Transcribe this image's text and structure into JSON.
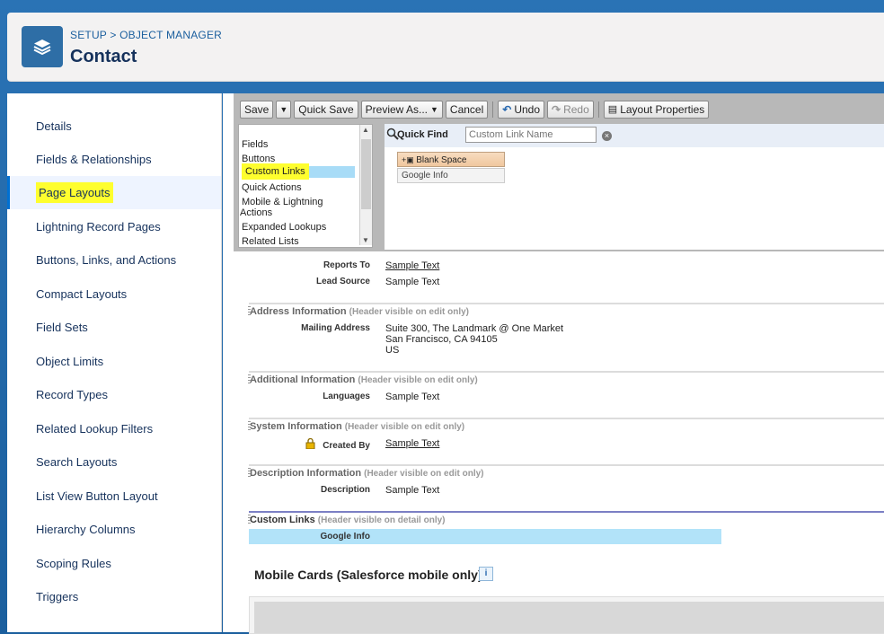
{
  "header": {
    "breadcrumb_setup": "SETUP",
    "breadcrumb_sep": ">",
    "breadcrumb_object_manager": "OBJECT MANAGER",
    "title": "Contact",
    "icon": "layers-icon"
  },
  "sidebar": {
    "items": [
      {
        "label": "Details"
      },
      {
        "label": "Fields & Relationships"
      },
      {
        "label": "Page Layouts",
        "active": true
      },
      {
        "label": "Lightning Record Pages"
      },
      {
        "label": "Buttons, Links, and Actions"
      },
      {
        "label": "Compact Layouts"
      },
      {
        "label": "Field Sets"
      },
      {
        "label": "Object Limits"
      },
      {
        "label": "Record Types"
      },
      {
        "label": "Related Lookup Filters"
      },
      {
        "label": "Search Layouts"
      },
      {
        "label": "List View Button Layout"
      },
      {
        "label": "Hierarchy Columns"
      },
      {
        "label": "Scoping Rules"
      },
      {
        "label": "Triggers"
      }
    ]
  },
  "toolbar": {
    "save": "Save",
    "quick_save": "Quick Save",
    "preview_as": "Preview As...",
    "cancel": "Cancel",
    "undo": "Undo",
    "redo": "Redo",
    "layout_properties": "Layout Properties"
  },
  "palette": {
    "categories": [
      "Fields",
      "Buttons",
      "Custom Links",
      "Quick Actions",
      "Mobile & Lightning",
      "Actions",
      "Expanded Lookups",
      "Related Lists"
    ],
    "selected_category": "Custom Links",
    "quick_find_label": "Quick Find",
    "quick_find_placeholder": "Custom Link Name",
    "tiles": [
      "Blank Space",
      "Google Info"
    ]
  },
  "layout": {
    "reports_to_label": "Reports To",
    "reports_to_value": "Sample Text",
    "lead_source_label": "Lead Source",
    "lead_source_value": "Sample Text",
    "address_section": "Address Information",
    "address_note": "(Header visible on edit only)",
    "mailing_address_label": "Mailing Address",
    "mailing_line1": "Suite 300, The Landmark @ One Market",
    "mailing_line2": "San Francisco, CA 94105",
    "mailing_line3": "US",
    "additional_section": "Additional Information",
    "additional_note": "(Header visible on edit only)",
    "languages_label": "Languages",
    "languages_value": "Sample Text",
    "system_section": "System Information",
    "system_note": "(Header visible on edit only)",
    "created_by_label": "Created By",
    "created_by_value": "Sample Text",
    "description_section": "Description Information",
    "description_note": "(Header visible on edit only)",
    "description_label": "Description",
    "description_value": "Sample Text",
    "custom_links_section": "Custom Links",
    "custom_links_note": "(Header visible on detail only)",
    "google_info_link": "Google Info",
    "mobile_cards_title": "Mobile Cards (Salesforce mobile only)",
    "info_glyph": "i"
  },
  "colors": {
    "highlight": "#fefe2e",
    "accent": "#0070d2",
    "selected_row": "#a8dcf7"
  }
}
